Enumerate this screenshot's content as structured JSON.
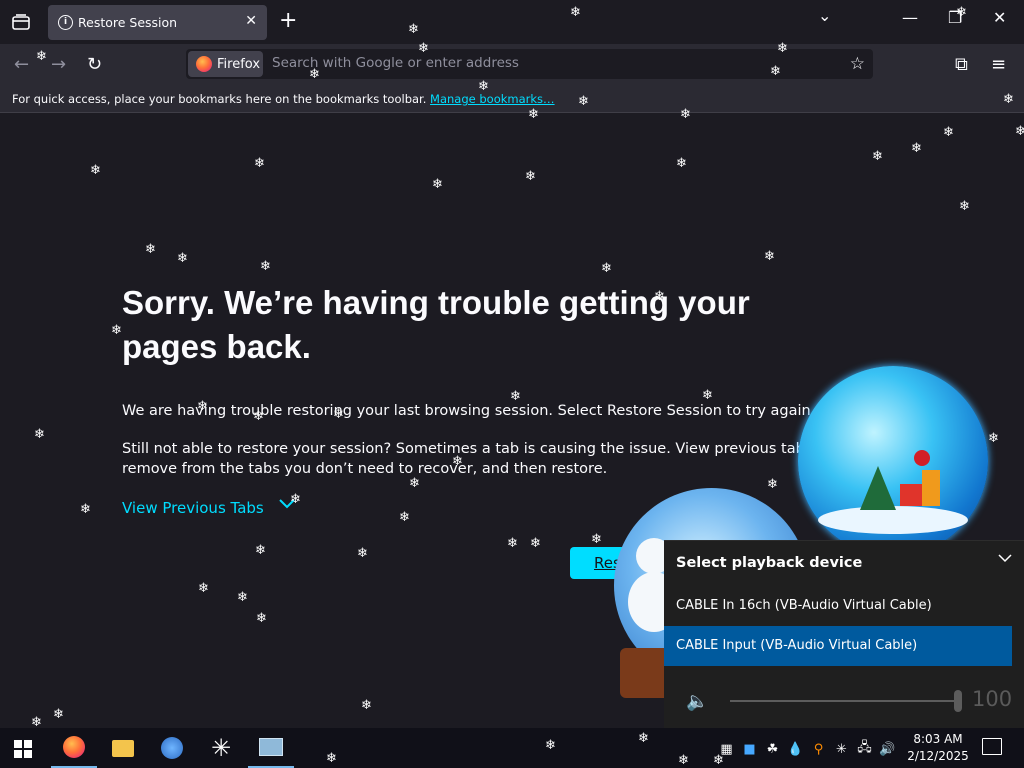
{
  "tabbar": {
    "tab_title": "Restore Session",
    "tab_close": "✕",
    "new_tab": "+",
    "list_all_tabs": "⌄",
    "minimize": "—",
    "restore": "❐",
    "close": "✕"
  },
  "navbar": {
    "back": "←",
    "forward": "→",
    "reload": "↻",
    "identity_label": "Firefox",
    "url_placeholder": "Search with Google or enter address",
    "star": "☆",
    "extensions": "⧉",
    "menu": "≡"
  },
  "bookmarks_bar": {
    "message": "For quick access, place your bookmarks here on the bookmarks toolbar.",
    "manage_link": "Manage bookmarks…"
  },
  "page": {
    "heading": "Sorry. We’re having trouble getting your pages back.",
    "paragraph1": "We are having trouble restoring your last browsing session. Select Restore Session to try again.",
    "paragraph2": "Still not able to restore your session? Sometimes a tab is causing the issue. View previous tabs, remove from the tabs you don’t need to recover, and then restore.",
    "view_previous_tabs": "View Previous Tabs",
    "restore_button": "Res"
  },
  "audio_flyout": {
    "header": "Select playback device",
    "devices": [
      "CABLE In 16ch (VB-Audio Virtual Cable)",
      "CABLE Input (VB-Audio Virtual Cable)"
    ],
    "selected_device": "CABLE Input (VB-Audio Virtual Cable)",
    "volume": "100"
  },
  "taskbar": {
    "time": "8:03 AM",
    "date": "2/12/2025"
  },
  "icons": {
    "tab_list": "tab-list-icon",
    "info": "info-icon",
    "firefox": "firefox-logo-icon",
    "star": "bookmark-star-icon",
    "extensions": "extensions-icon",
    "menu": "hamburger-menu-icon",
    "chevron": "chevron-down-icon",
    "speaker": "speaker-icon",
    "snowflake": "snowflake-icon"
  },
  "colors": {
    "accent": "#00ddff",
    "background": "#1c1b22",
    "toolbar": "#2b2a33",
    "selected_device": "#005a9e"
  }
}
